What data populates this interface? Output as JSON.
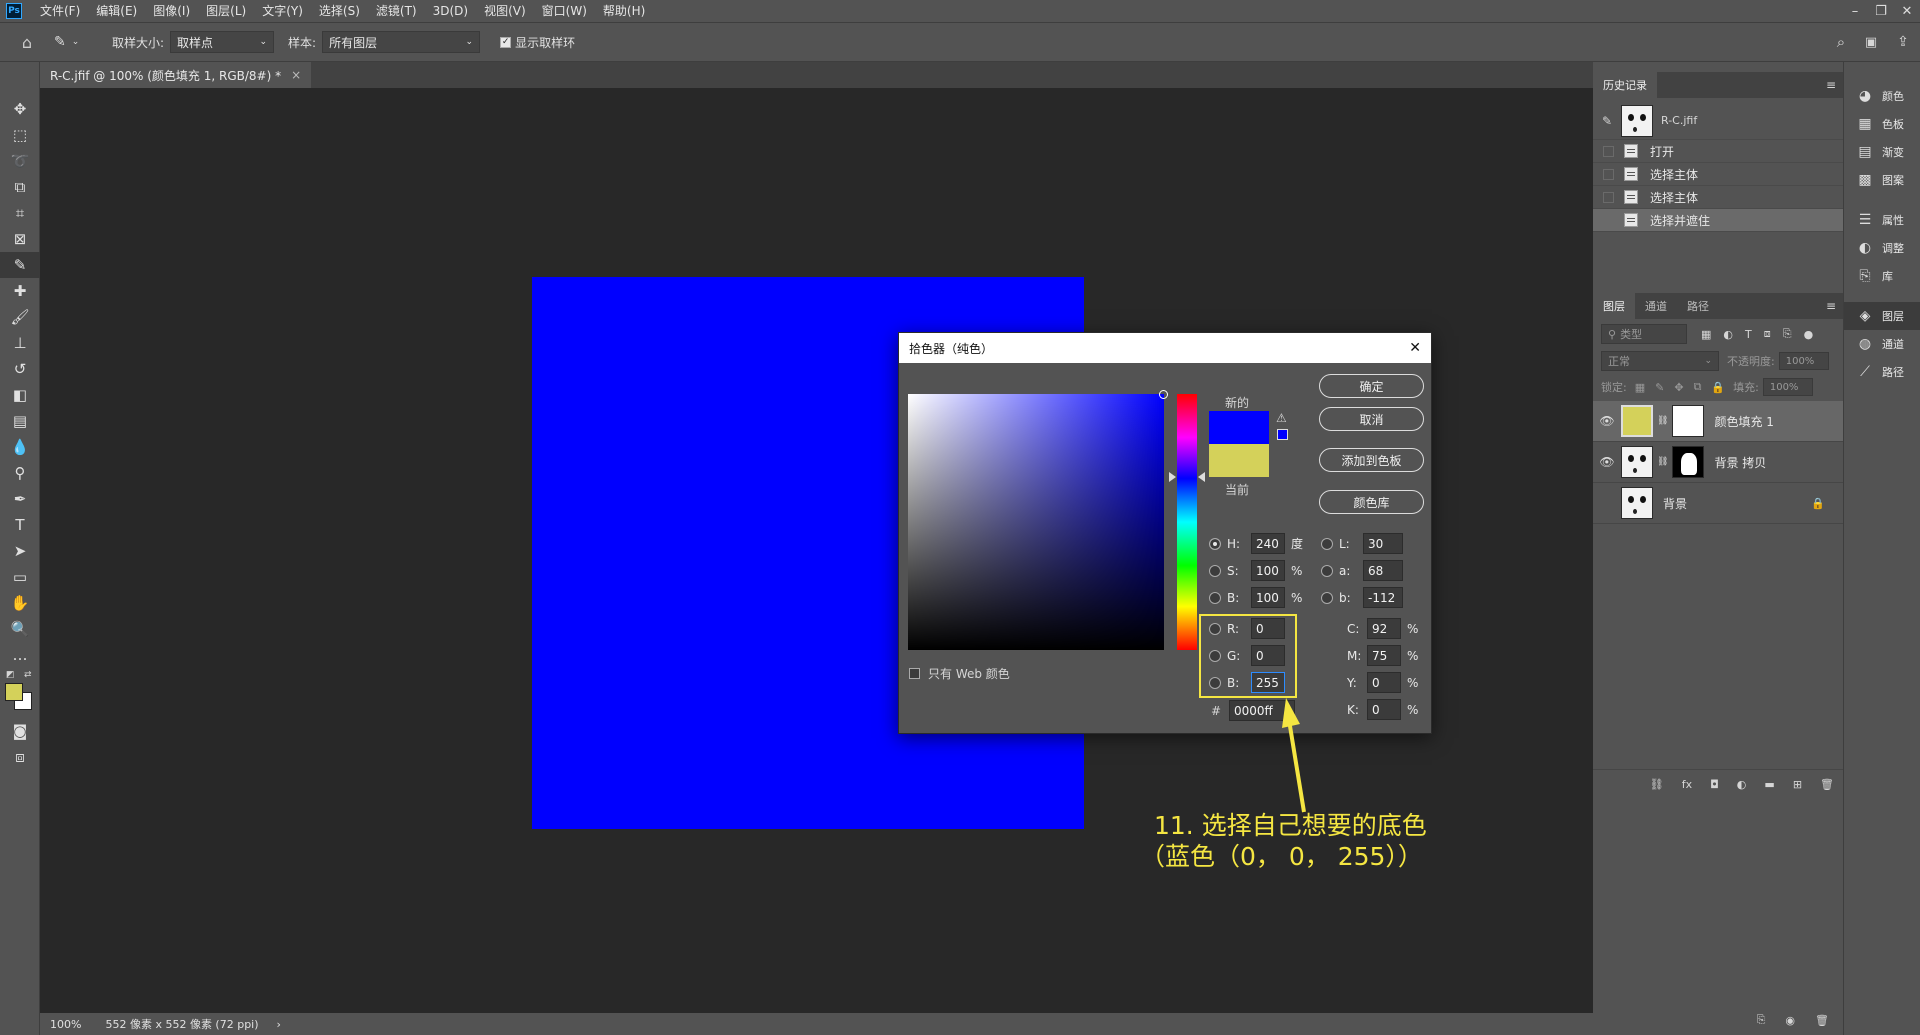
{
  "colors": {
    "accent_yellow": "#f5e642",
    "doc_fill": "#0000ff",
    "current_color": "#d4d15a",
    "new_color": "#0000ff"
  },
  "menubar": {
    "logo": "Ps",
    "items": [
      "文件(F)",
      "编辑(E)",
      "图像(I)",
      "图层(L)",
      "文字(Y)",
      "选择(S)",
      "滤镜(T)",
      "3D(D)",
      "视图(V)",
      "窗口(W)",
      "帮助(H)"
    ]
  },
  "options": {
    "sample_size_label": "取样大小:",
    "sample_size_value": "取样点",
    "sample_label": "样本:",
    "sample_value": "所有图层",
    "show_ring_label": "显示取样环"
  },
  "document": {
    "tab_title": "R-C.jfif @ 100% (颜色填充 1, RGB/8#) *",
    "tab_close": "×"
  },
  "status": {
    "zoom": "100%",
    "size": "552 像素 x 552 像素 (72 ppi)",
    "arrow": "›"
  },
  "history": {
    "tab": "历史记录",
    "snapshot": "R-C.jfif",
    "steps": [
      "打开",
      "选择主体",
      "选择主体",
      "选择并遮住"
    ]
  },
  "layers": {
    "tabs": [
      "图层",
      "通道",
      "路径"
    ],
    "filter_placeholder": "类型",
    "blend_mode": "正常",
    "opacity_label": "不透明度:",
    "opacity_value": "100%",
    "lock_label": "锁定:",
    "fill_label": "填充:",
    "fill_value": "100%",
    "items": [
      {
        "name": "颜色填充 1"
      },
      {
        "name": "背景 拷贝"
      },
      {
        "name": "背景"
      }
    ]
  },
  "side_panels": [
    "颜色",
    "色板",
    "渐变",
    "图案",
    "属性",
    "调整",
    "库",
    "图层",
    "通道",
    "路径"
  ],
  "dialog": {
    "title": "拾色器（纯色）",
    "close": "✕",
    "ok": "确定",
    "cancel": "取消",
    "add_swatch": "添加到色板",
    "color_library": "颜色库",
    "new_label": "新的",
    "current_label": "当前",
    "web_only_label": "只有 Web 颜色",
    "hsb": [
      {
        "label": "H:",
        "value": "240",
        "unit": "度"
      },
      {
        "label": "S:",
        "value": "100",
        "unit": "%"
      },
      {
        "label": "B:",
        "value": "100",
        "unit": "%"
      }
    ],
    "lab": [
      {
        "label": "L:",
        "value": "30"
      },
      {
        "label": "a:",
        "value": "68"
      },
      {
        "label": "b:",
        "value": "-112"
      }
    ],
    "rgb": [
      {
        "label": "R:",
        "value": "0"
      },
      {
        "label": "G:",
        "value": "0"
      },
      {
        "label": "B:",
        "value": "255"
      }
    ],
    "cmyk": [
      {
        "label": "C:",
        "value": "92",
        "unit": "%"
      },
      {
        "label": "M:",
        "value": "75",
        "unit": "%"
      },
      {
        "label": "Y:",
        "value": "0",
        "unit": "%"
      },
      {
        "label": "K:",
        "value": "0",
        "unit": "%"
      }
    ],
    "hex_label": "#",
    "hex_value": "0000ff"
  },
  "annotation": {
    "line1": "11. 选择自己想要的底色",
    "line2": "（蓝色（0，  0，  255））"
  }
}
